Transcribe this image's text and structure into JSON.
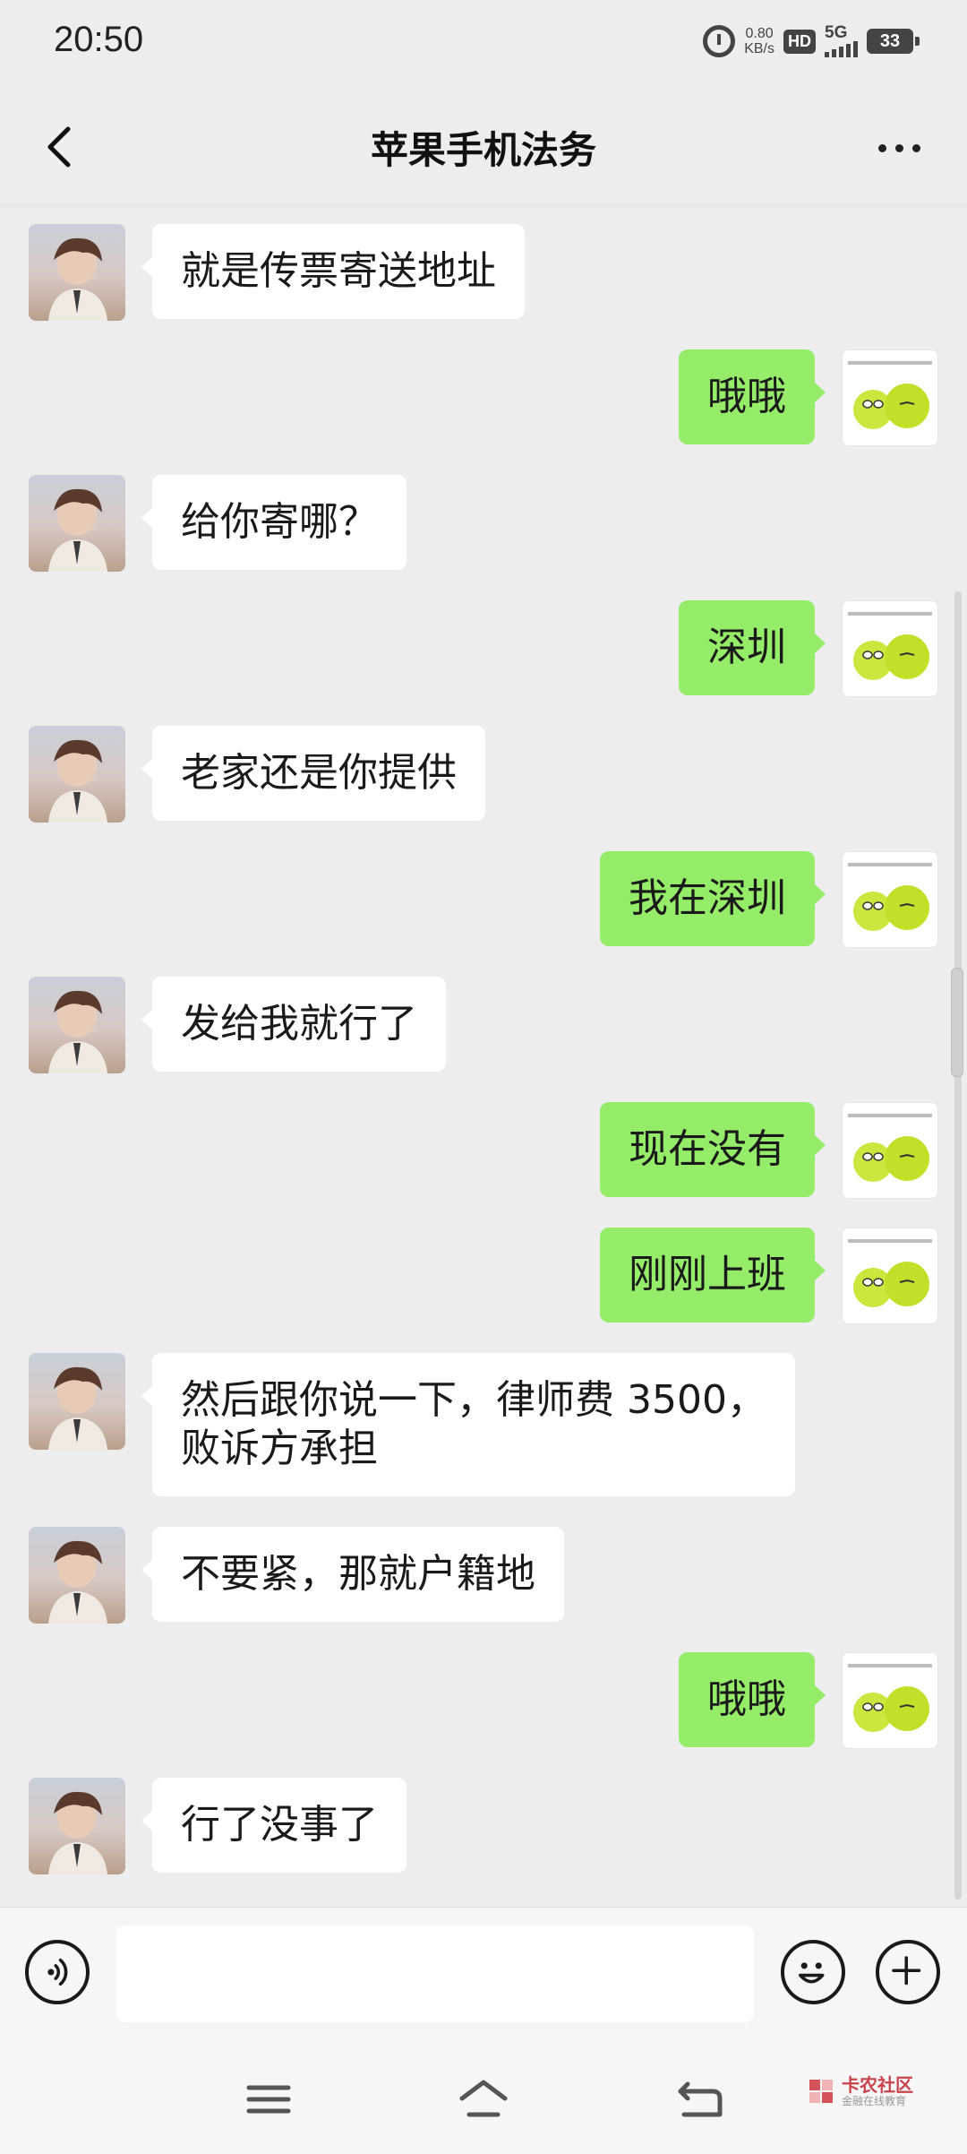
{
  "status_bar": {
    "time": "20:50",
    "speed_value": "0.80",
    "speed_unit": "KB/s",
    "hd": "HD",
    "network": "5G",
    "battery": "33"
  },
  "header": {
    "title": "苹果手机法务"
  },
  "messages": [
    {
      "side": "left",
      "text": "就是传票寄送地址"
    },
    {
      "side": "right",
      "text": "哦哦"
    },
    {
      "side": "left",
      "text": "给你寄哪？"
    },
    {
      "side": "right",
      "text": "深圳"
    },
    {
      "side": "left",
      "text": "老家还是你提供"
    },
    {
      "side": "right",
      "text": "我在深圳"
    },
    {
      "side": "left",
      "text": "发给我就行了"
    },
    {
      "side": "right",
      "text": "现在没有"
    },
    {
      "side": "right",
      "text": "刚刚上班"
    },
    {
      "side": "left",
      "text": "然后跟你说一下，律师费 3500，\n败诉方承担"
    },
    {
      "side": "left",
      "text": "不要紧，那就户籍地"
    },
    {
      "side": "right",
      "text": "哦哦"
    },
    {
      "side": "left",
      "text": "行了没事了"
    }
  ],
  "input": {
    "placeholder": ""
  },
  "watermark": {
    "title": "卡农社区",
    "subtitle": "金融在线教育"
  },
  "colors": {
    "background": "#ededed",
    "sent_bubble": "#95ec69",
    "received_bubble": "#ffffff"
  },
  "icons": [
    "back-arrow-icon",
    "more-icon",
    "voice-icon",
    "emoji-icon",
    "plus-icon",
    "menu-icon",
    "home-icon",
    "back-nav-icon"
  ]
}
